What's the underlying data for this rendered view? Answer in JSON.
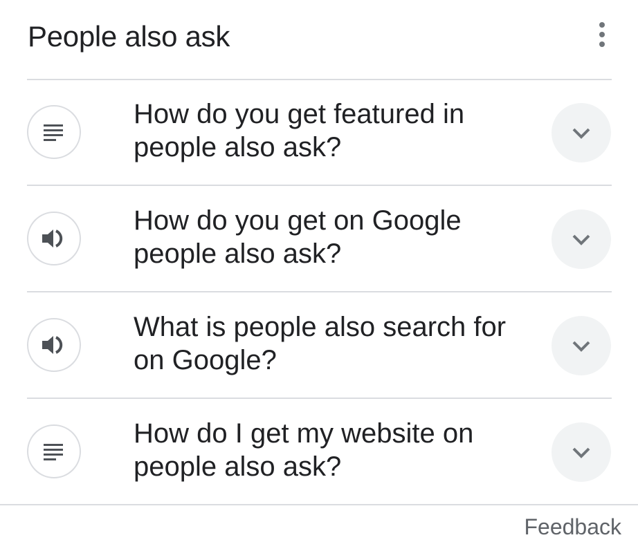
{
  "header": {
    "title": "People also ask",
    "more_icon": "more-vertical-icon"
  },
  "questions": [
    {
      "text": "How do you get featured in people also ask?",
      "icon": "text-snippet-icon"
    },
    {
      "text": "How do you get on Google people also ask?",
      "icon": "speaker-icon"
    },
    {
      "text": "What is people also search for on Google?",
      "icon": "speaker-icon"
    },
    {
      "text": "How do I get my website on people also ask?",
      "icon": "text-snippet-icon"
    }
  ],
  "expand_icon": "chevron-down-icon",
  "footer": {
    "feedback_label": "Feedback"
  },
  "colors": {
    "text_primary": "#202124",
    "text_secondary": "#5f6368",
    "icon_gray": "#4d5156",
    "divider": "#dadce0",
    "expand_bg": "#f1f3f4"
  }
}
